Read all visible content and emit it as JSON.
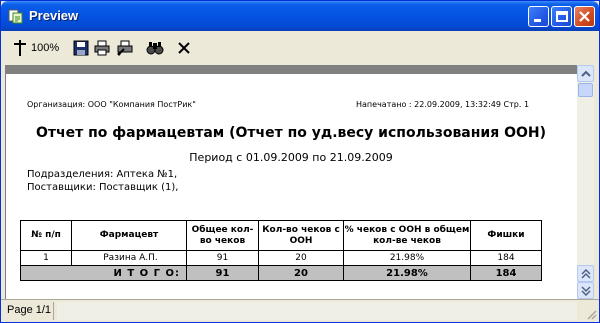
{
  "window": {
    "title": "Preview"
  },
  "toolbar": {
    "zoom_label": "100%"
  },
  "status": {
    "page_label": "Page 1/1"
  },
  "report": {
    "organization": "Организация: ООО \"Компания ПостРик\"",
    "printed": "Напечатано : 22.09.2009, 13:32:49 Стр. 1",
    "title": "Отчет по фармацевтам (Отчет по уд.весу использования ООН)",
    "period": "Период  с 01.09.2009 по 21.09.2009",
    "department": "Подразделения: Аптека №1,",
    "suppliers": "Поставщики: Поставщик     (1),"
  },
  "table": {
    "headers": [
      "№ п/п",
      "Фармацевт",
      "Общее кол-во чеков",
      "Кол-во чеков с ООН",
      "% чеков с ООН в общем кол-ве чеков",
      "Фишки"
    ],
    "rows": [
      [
        "1",
        "Разина А.П.",
        "91",
        "20",
        "21.98%",
        "184"
      ]
    ],
    "total": {
      "label": "И Т О Г О:",
      "values": [
        "91",
        "20",
        "21.98%",
        "184"
      ]
    }
  }
}
